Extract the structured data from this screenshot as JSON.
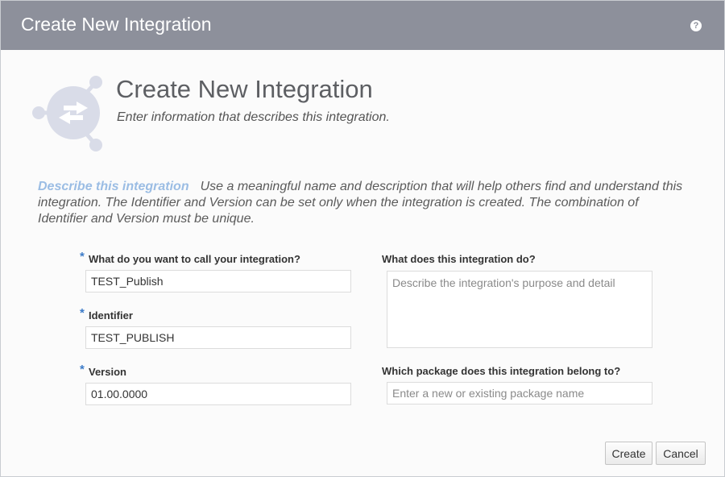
{
  "window": {
    "title": "Create New Integration",
    "help_icon": "help-icon",
    "help_glyph": "?"
  },
  "header": {
    "title": "Create New Integration",
    "subtitle": "Enter information that describes this integration.",
    "icon": "integration-icon"
  },
  "describe": {
    "lead": "Describe this integration",
    "text": "Use a meaningful name and description that will help others find and understand this integration. The Identifier and Version can be set only when the integration is created. The combination of Identifier and Version must be unique."
  },
  "form": {
    "required_marker": "*",
    "name": {
      "label": "What do you want to call your integration?",
      "value": "TEST_Publish"
    },
    "identifier": {
      "label": "Identifier",
      "value": "TEST_PUBLISH"
    },
    "version": {
      "label": "Version",
      "value": "01.00.0000"
    },
    "description": {
      "label": "What does this integration do?",
      "placeholder": "Describe the integration's purpose and detail"
    },
    "package": {
      "label": "Which package does this integration belong to?",
      "placeholder": "Enter a new or existing package name"
    }
  },
  "buttons": {
    "create": "Create",
    "cancel": "Cancel"
  },
  "colors": {
    "titlebar": "#8d909b",
    "accent": "#9bbde4",
    "required": "#3d7cc9"
  }
}
